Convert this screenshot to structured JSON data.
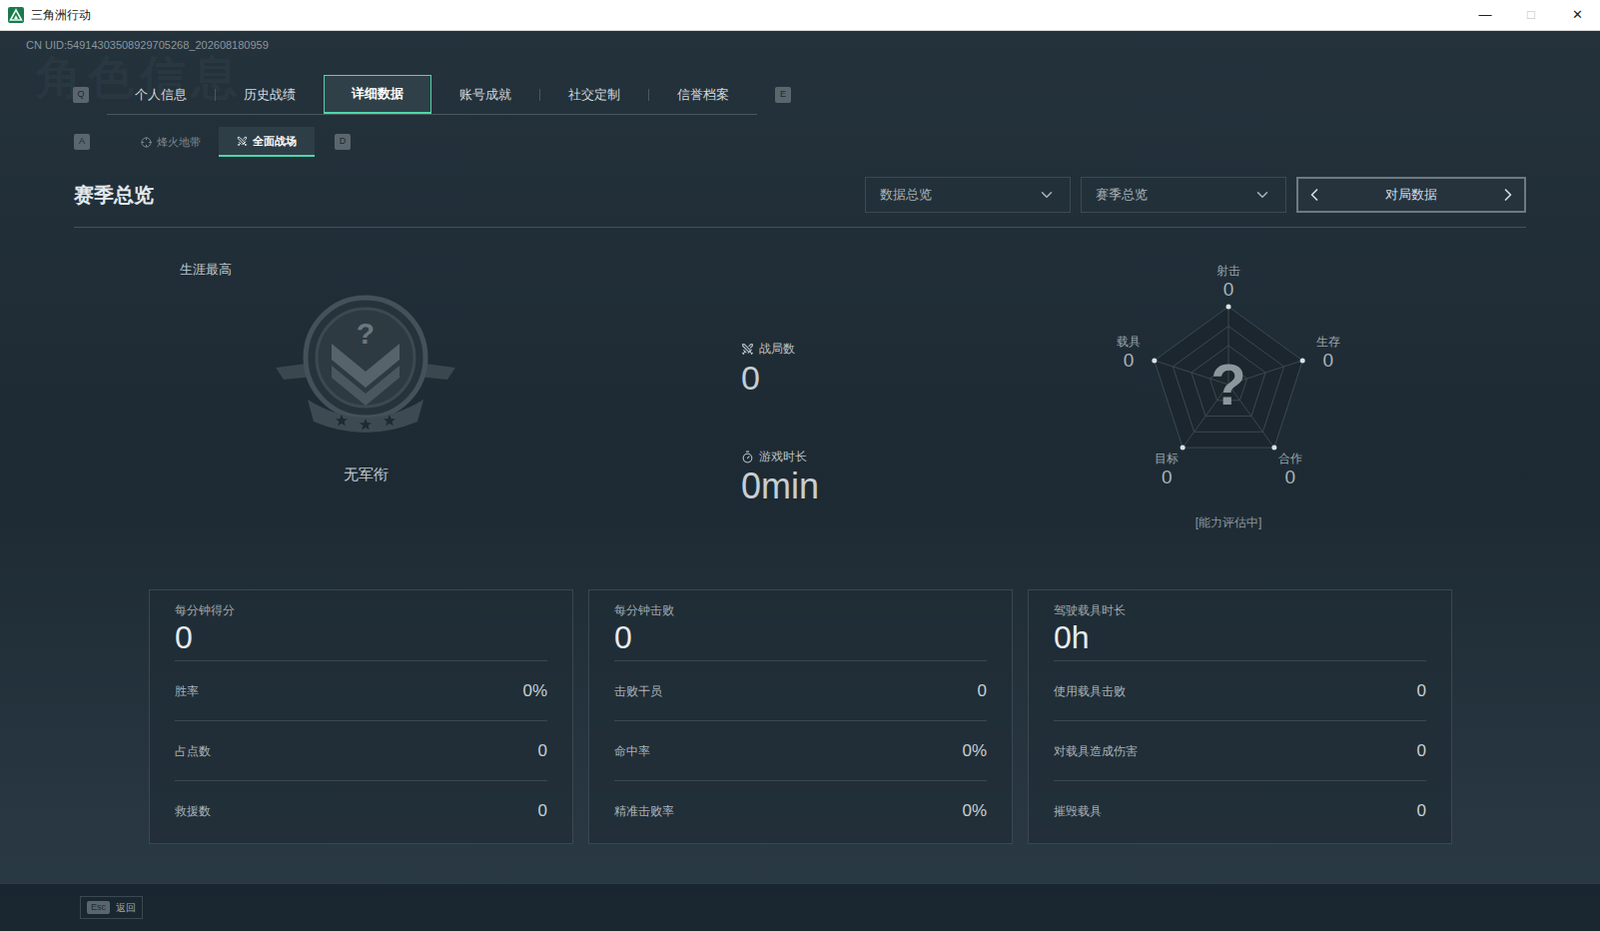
{
  "window": {
    "title": "三角洲行动",
    "controls": [
      "—",
      "□",
      "✕"
    ]
  },
  "uid": "CN UID:54914303508929705268_202608180959",
  "watermark": "角色信息",
  "tabs": {
    "prev_key": "Q",
    "next_key": "E",
    "items": [
      {
        "label": "个人信息",
        "selected": false
      },
      {
        "label": "历史战绩",
        "selected": false
      },
      {
        "label": "详细数据",
        "selected": true
      },
      {
        "label": "账号成就",
        "selected": false
      },
      {
        "label": "社交定制",
        "selected": false
      },
      {
        "label": "信誉档案",
        "selected": false
      }
    ]
  },
  "subtabs": {
    "prev_key": "A",
    "next_key": "D",
    "items": [
      {
        "label": "烽火地带",
        "selected": false
      },
      {
        "label": "全面战场",
        "selected": true
      }
    ]
  },
  "section": {
    "title": "赛季总览",
    "filters": [
      "数据总览",
      "赛季总览"
    ],
    "pager": {
      "label": "对局数据"
    }
  },
  "rank": {
    "caption": "生涯最高",
    "badge": "?",
    "name": "无军衔"
  },
  "summary": [
    {
      "label": "战局数",
      "value": "0"
    },
    {
      "label": "游戏时长",
      "value": "0min"
    }
  ],
  "radar": {
    "center": "?",
    "status": "[能力评估中]",
    "axes": [
      {
        "label": "射击",
        "value": "0",
        "level": 0
      },
      {
        "label": "生存",
        "value": "0",
        "level": 0
      },
      {
        "label": "合作",
        "value": "0",
        "level": 0
      },
      {
        "label": "目标",
        "value": "0",
        "level": 0
      },
      {
        "label": "载具",
        "value": "0",
        "level": 0
      }
    ]
  },
  "cards": [
    {
      "title": "每分钟得分",
      "value": "0",
      "rows": [
        {
          "label": "胜率",
          "value": "0%"
        },
        {
          "label": "占点数",
          "value": "0"
        },
        {
          "label": "救援数",
          "value": "0"
        }
      ]
    },
    {
      "title": "每分钟击败",
      "value": "0",
      "rows": [
        {
          "label": "击败干员",
          "value": "0"
        },
        {
          "label": "命中率",
          "value": "0%"
        },
        {
          "label": "精准击败率",
          "value": "0%"
        }
      ]
    },
    {
      "title": "驾驶载具时长",
      "value": "0h",
      "rows": [
        {
          "label": "使用载具击败",
          "value": "0"
        },
        {
          "label": "对载具造成伤害",
          "value": "0"
        },
        {
          "label": "摧毁载具",
          "value": "0"
        }
      ]
    }
  ],
  "footer": {
    "key": "Esc",
    "label": "返回"
  }
}
